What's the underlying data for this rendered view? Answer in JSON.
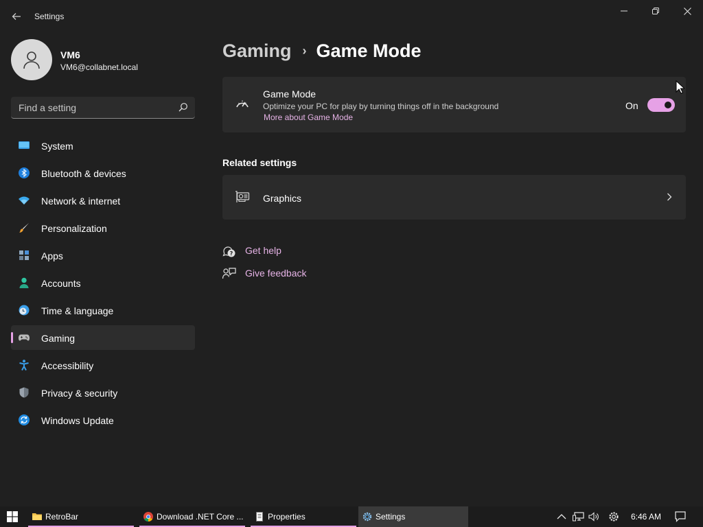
{
  "window": {
    "title": "Settings",
    "back_icon": "back-arrow-icon",
    "controls": [
      "minimize-icon",
      "restore-icon",
      "close-icon"
    ]
  },
  "profile": {
    "name": "VM6",
    "email": "VM6@collabnet.local",
    "avatar_icon": "user-icon"
  },
  "search": {
    "placeholder": "Find a setting",
    "value": "",
    "icon": "search-icon"
  },
  "nav": {
    "items": [
      {
        "label": "System",
        "icon": "system-display-icon",
        "active": false
      },
      {
        "label": "Bluetooth & devices",
        "icon": "bluetooth-icon",
        "active": false
      },
      {
        "label": "Network & internet",
        "icon": "wifi-icon",
        "active": false
      },
      {
        "label": "Personalization",
        "icon": "paintbrush-icon",
        "active": false
      },
      {
        "label": "Apps",
        "icon": "apps-icon",
        "active": false
      },
      {
        "label": "Accounts",
        "icon": "person-icon",
        "active": false
      },
      {
        "label": "Time & language",
        "icon": "clock-globe-icon",
        "active": false
      },
      {
        "label": "Gaming",
        "icon": "gamepad-icon",
        "active": true
      },
      {
        "label": "Accessibility",
        "icon": "accessibility-icon",
        "active": false
      },
      {
        "label": "Privacy & security",
        "icon": "shield-icon",
        "active": false
      },
      {
        "label": "Windows Update",
        "icon": "update-icon",
        "active": false
      }
    ]
  },
  "breadcrumb": {
    "parent": "Gaming",
    "separator": "›",
    "current": "Game Mode"
  },
  "game_mode": {
    "title": "Game Mode",
    "description": "Optimize your PC for play by turning things off in the background",
    "link": "More about Game Mode",
    "state_label": "On",
    "enabled": true,
    "icon": "gauge-icon"
  },
  "related": {
    "heading": "Related settings",
    "items": [
      {
        "label": "Graphics",
        "icon": "graphics-card-icon"
      }
    ]
  },
  "help": {
    "get_help": "Get help",
    "give_feedback": "Give feedback"
  },
  "taskbar": {
    "start_icon": "windows-start-icon",
    "apps": [
      {
        "label": "RetroBar",
        "icon": "folder-icon"
      },
      {
        "label": "Download .NET Core ...",
        "icon": "chrome-icon"
      },
      {
        "label": "Properties",
        "icon": "document-icon"
      },
      {
        "label": "Settings",
        "icon": "gear-icon",
        "active": true
      }
    ],
    "tray_icons": [
      "chevron-up-icon",
      "network-icon",
      "volume-icon",
      "settings-gear-icon",
      "notification-icon"
    ],
    "time": "6:46 AM"
  },
  "colors": {
    "background": "#202020",
    "card": "#2b2b2b",
    "accent": "#e6a1e6",
    "link": "#e6b3e6",
    "taskbar": "#1c1c1c"
  }
}
